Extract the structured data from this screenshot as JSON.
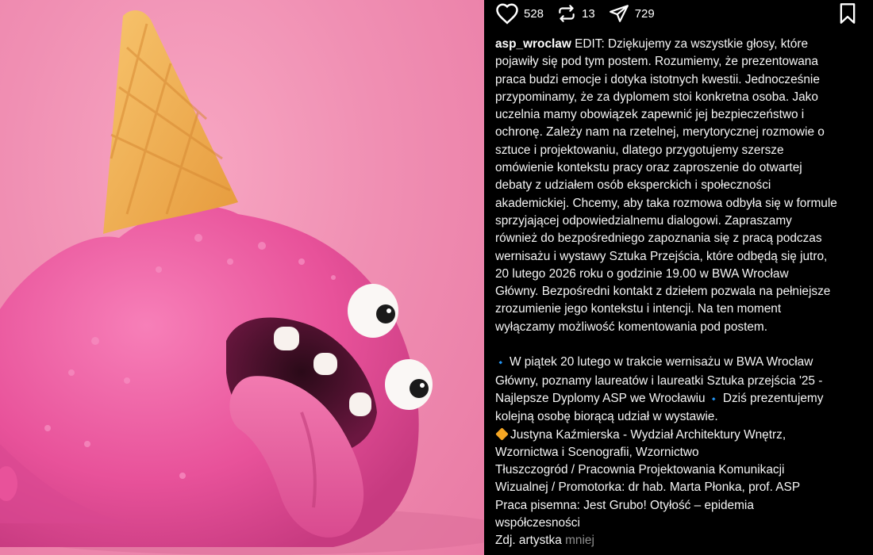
{
  "post": {
    "username": "asp_wroclaw",
    "likes": "528",
    "reposts": "13",
    "shares": "729",
    "more_label": "mniej",
    "caption_lines": [
      "EDIT: Dziękujemy za wszystkie głosy, które",
      "pojawiły się pod tym postem. Rozumiemy, że prezentowana",
      "praca budzi emocje i dotyka istotnych kwestii. Jednocześnie",
      "przypominamy, że za dyplomem stoi konkretna osoba. Jako",
      "uczelnia mamy obowiązek zapewnić jej bezpieczeństwo i",
      "ochronę. Zależy nam na rzetelnej, merytorycznej rozmowie o",
      "sztuce i projektowaniu, dlatego przygotujemy szersze",
      "omówienie kontekstu pracy oraz zaproszenie do otwartej",
      "debaty z udziałem osób eksperckich i społeczności",
      "akademickiej. Chcemy, aby taka rozmowa odbyła się w formule",
      "sprzyjającej odpowiedzialnemu dialogowi. Zapraszamy",
      "również do bezpośredniego zapoznania się z pracą podczas",
      "wernisażu i wystawy Sztuka Przejścia, które odbędą się jutro,",
      "20 lutego 2026 roku o godzinie 19.00 w BWA Wrocław",
      "Główny. Bezpośredni kontakt z dziełem pozwala na pełniejsze",
      "zrozumienie jego kontekstu i intencji. Na ten moment",
      "wyłączamy możliwość komentowania pod postem."
    ],
    "second_block": {
      "line1": "W piątek 20 lutego w trakcie wernisażu w BWA Wrocław",
      "line2": "Główny, poznamy laureatów i laureatki Sztuka przejścia '25 -",
      "line3a": "Najlepsze Dyplomy ASP we Wrocławiu ",
      "line3b": " Dziś prezentujemy",
      "line4": "kolejną osobę biorącą udział w wystawie.",
      "line5": "Justyna Kaźmierska - Wydział Architektury Wnętrz,",
      "line6": "Wzornictwa i Scenografii, Wzornictwo",
      "line7": "Tłuszczogród / Pracownia Projektowania Komunikacji",
      "line8": "Wizualnej / Promotorka: dr hab. Marta Płonka, prof. ASP",
      "line9": "Praca pisemna: Jest Grubo! Otyłość – epidemia",
      "line10": "współczesności",
      "line11": "Zdj. artystka "
    },
    "diamond_glyph": "🔹"
  },
  "icons": {
    "like": "heart-icon",
    "repost": "repost-icon",
    "share": "send-icon",
    "save": "bookmark-icon"
  },
  "colors": {
    "background": "#000000",
    "pink": "#ee8fb4",
    "cone": "#f3b55c",
    "muted": "#8e8e8e"
  }
}
